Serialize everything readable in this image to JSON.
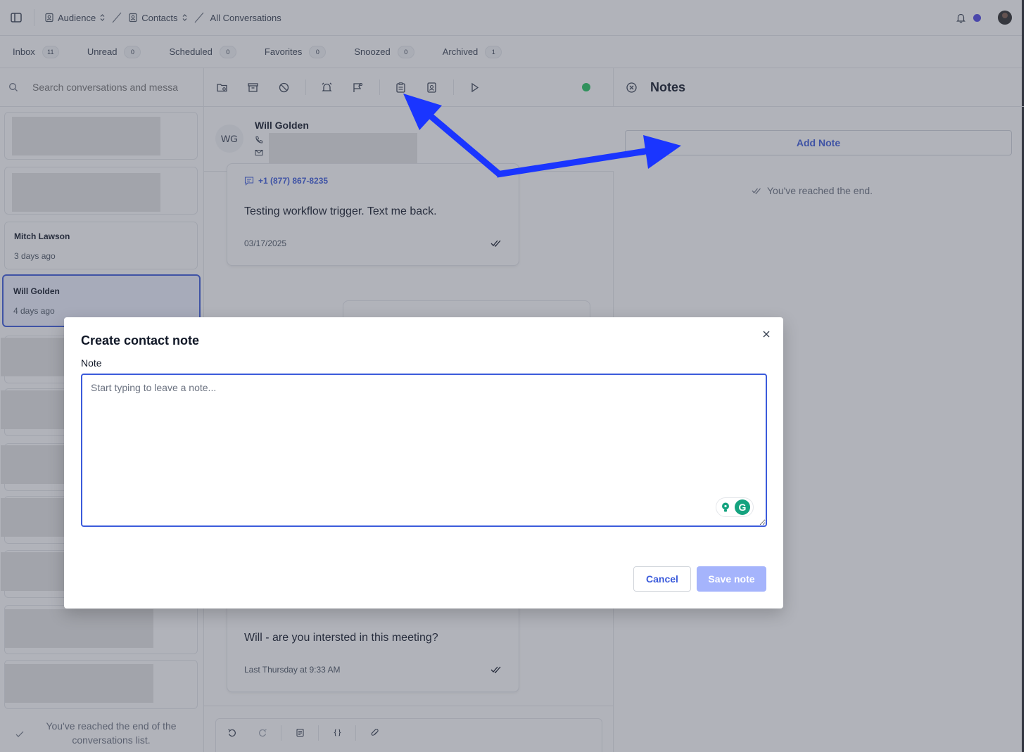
{
  "breadcrumb": {
    "audience": "Audience",
    "contacts": "Contacts",
    "current": "All Conversations"
  },
  "colors": {
    "accent": "#3b5bdb",
    "status_online": "#22c55e",
    "annotation_arrow": "#1a35ff"
  },
  "tabs": [
    {
      "label": "Inbox",
      "count": "11"
    },
    {
      "label": "Unread",
      "count": "0"
    },
    {
      "label": "Scheduled",
      "count": "0"
    },
    {
      "label": "Favorites",
      "count": "0"
    },
    {
      "label": "Snoozed",
      "count": "0"
    },
    {
      "label": "Archived",
      "count": "1"
    }
  ],
  "search": {
    "placeholder": "Search conversations and messa"
  },
  "conversations": [
    {
      "name": "Mitch Lawson",
      "time": "3 days ago"
    },
    {
      "name": "Will Golden",
      "time": "4 days ago",
      "selected": true
    }
  ],
  "conversations_end": "You've reached the end of the conversations list.",
  "contact": {
    "initials": "WG",
    "name": "Will Golden"
  },
  "messages": [
    {
      "from": "+1 (877) 867-8235",
      "text": "Testing workflow trigger. Text me back.",
      "date": "03/17/2025"
    },
    {
      "text": "Will - are you intersted in this meeting?",
      "date": "Last Thursday at 9:33 AM"
    }
  ],
  "notes": {
    "title": "Notes",
    "add_label": "Add Note",
    "end_text": "You've reached the end."
  },
  "modal": {
    "title": "Create contact note",
    "field_label": "Note",
    "placeholder": "Start typing to leave a note...",
    "cancel_label": "Cancel",
    "save_label": "Save note",
    "grammarly_letter": "G"
  }
}
